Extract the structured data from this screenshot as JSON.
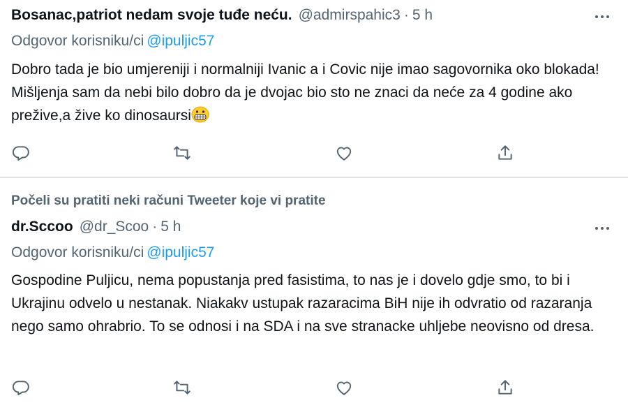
{
  "tweets": [
    {
      "social_context": "",
      "name": "Bosanac,patriot nedam svoje tuđe neću.",
      "handle": "@admirspahic3",
      "separator": "·",
      "time": "5 h",
      "reply_prefix": "Odgovor korisniku/ci",
      "reply_to": "@ipuljic57",
      "text": "Dobro tada je bio umjereniji i normalniji Ivanic a i Covic nije imao sagovornika oko blokada! Mišljenja sam da nebi bilo dobro da je dvojac bio sto ne znaci da neće za 4 godine ako prežive,a žive ko dinosaursi",
      "emoji": "grimacing-face-emoji"
    },
    {
      "social_context": "Počeli su pratiti neki računi Tweeter koje vi pratite",
      "name": "dr.Sccoo",
      "handle": "@dr_Scoo",
      "separator": "·",
      "time": "5 h",
      "reply_prefix": "Odgovor korisniku/ci",
      "reply_to": "@ipuljic57",
      "text": "Gospodine Puljicu, nema popustanja pred fasistima, to nas je i dovelo gdje smo, to bi i Ukrajinu odvelo u nestanak. Niakakv ustupak razaracima BiH nije ih odvratio od razaranja nego samo ohrabrio. To se odnosi i na SDA i na sve stranacke uhljebe neovisno od dresa.",
      "emoji": ""
    }
  ],
  "actions": [
    "reply-icon",
    "retweet-icon",
    "like-icon",
    "share-icon"
  ],
  "colors": {
    "text": "#0f1419",
    "secondary": "#536471",
    "link": "#1d9bf0",
    "divider": "#dfe3e6"
  }
}
